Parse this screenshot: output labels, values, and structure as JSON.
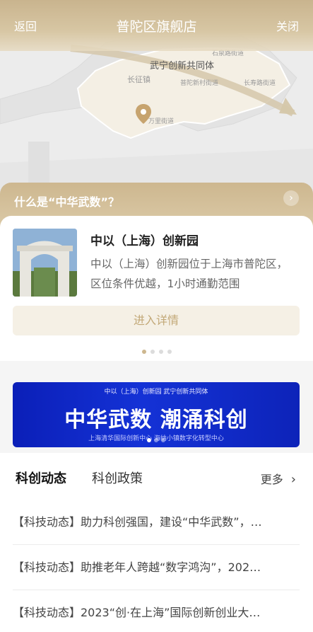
{
  "header": {
    "back": "返回",
    "title": "普陀区旗舰店",
    "close": "关闭"
  },
  "map": {
    "region_label": "武宁创新共同体",
    "labels": [
      "长征镇",
      "石泉路街道",
      "普陀新村街道",
      "长寿路街道",
      "万里街道"
    ],
    "pin_icon": "location-pin-icon"
  },
  "intro_bar": {
    "question": "什么是“中华武数”？",
    "arrow_icon": "chevron-right-icon"
  },
  "card": {
    "title": "中以（上海）创新园",
    "description": "中以（上海）创新园位于上海市普陀区，区位条件优越，1小时通勤范围",
    "button": "进入详情",
    "dots": 4,
    "active_dot": 0
  },
  "banner": {
    "top_text": "中以（上海）创新园   武宁创新共同体",
    "main_text": "中华武数 潮涌科创",
    "bottom_text": "上海清华国际创新中心   海纳小镇数字化转型中心",
    "dots": 3,
    "active_dot": 0
  },
  "news_section": {
    "tabs": [
      "科创动态",
      "科创政策"
    ],
    "active_tab": 0,
    "more": "更多",
    "items": [
      "【科技动态】助力科创强国，建设“中华武数”，…",
      "【科技动态】助推老年人跨越“数字鸿沟”，202…",
      "【科技动态】2023“创·在上海”国际创新创业大…"
    ]
  }
}
